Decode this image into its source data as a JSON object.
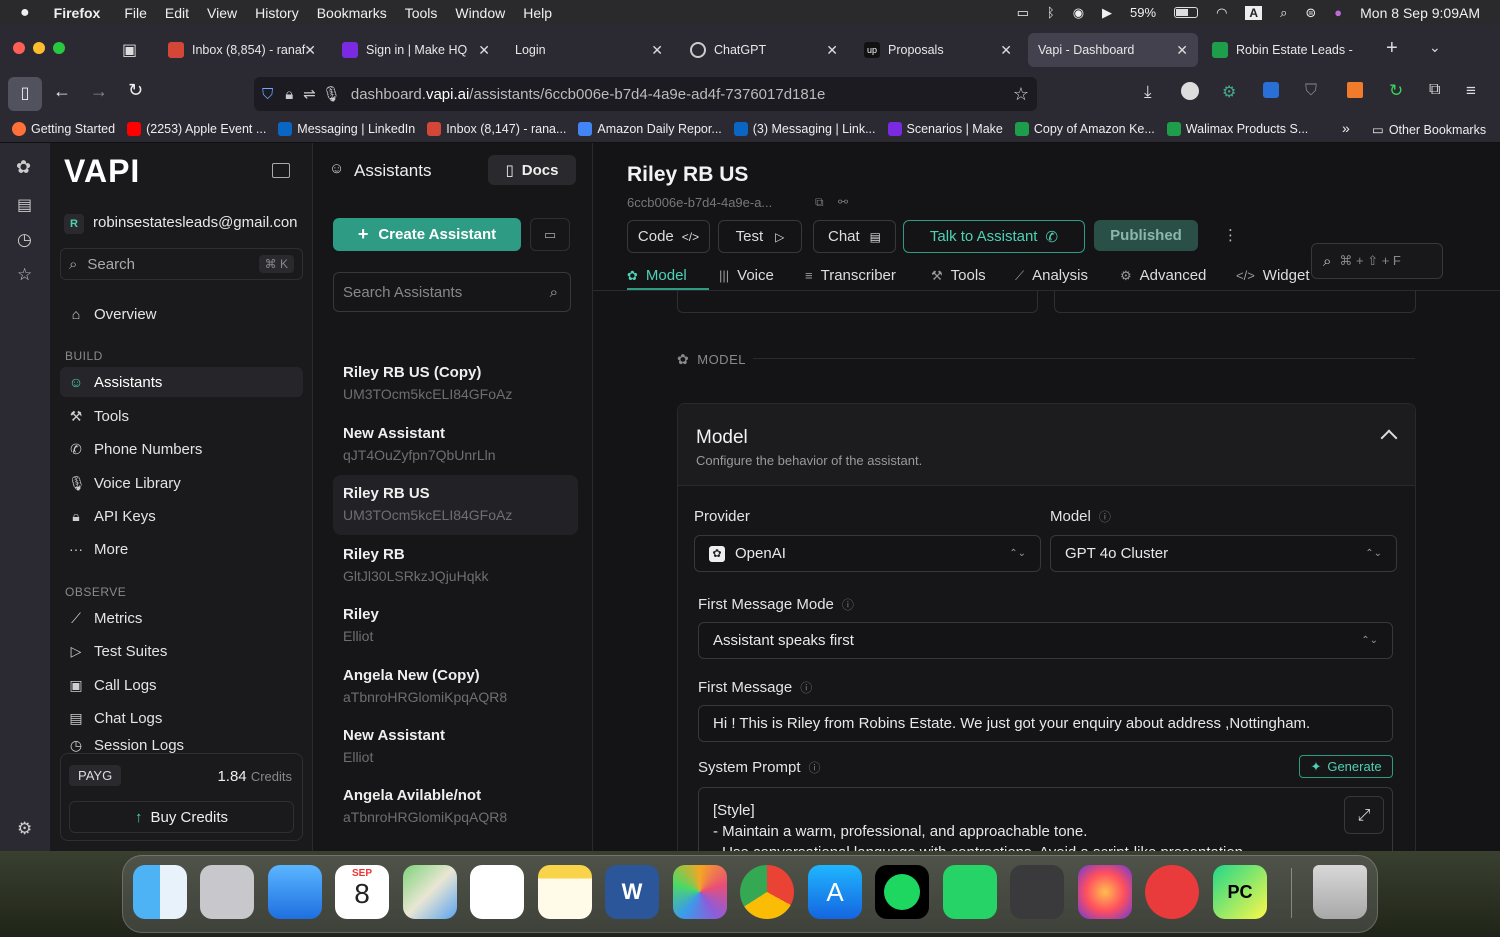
{
  "menubar": {
    "app": "Firefox",
    "items": [
      "File",
      "Edit",
      "View",
      "History",
      "Bookmarks",
      "Tools",
      "Window",
      "Help"
    ],
    "battery": "59%",
    "datetime": "Mon 8 Sep  9:09AM",
    "input_source": "A"
  },
  "tabs": [
    {
      "label": "Inbox (8,854) - ranaf",
      "color": "#d44638"
    },
    {
      "label": "Sign in | Make HQ",
      "color": "#7a2be2"
    },
    {
      "label": "Login",
      "color": ""
    },
    {
      "label": "ChatGPT",
      "color": "#cccccc"
    },
    {
      "label": "Proposals",
      "color": "#222222"
    },
    {
      "label": "Vapi - Dashboard",
      "color": ""
    },
    {
      "label": "Robin Estate Leads -",
      "color": "#1e9e4a"
    }
  ],
  "url": {
    "prefix": "dashboard.",
    "domain": "vapi.ai",
    "path": "/assistants/6ccb006e-b7d4-4a9e-ad4f-7376017d181e"
  },
  "bookmarks": [
    {
      "label": "Getting Started",
      "color": "#ff7139"
    },
    {
      "label": "(2253) Apple Event ...",
      "color": "#ff0000"
    },
    {
      "label": "Messaging | LinkedIn",
      "color": "#0a66c2"
    },
    {
      "label": "Inbox (8,147) - rana...",
      "color": "#d44638"
    },
    {
      "label": "Amazon Daily Repor...",
      "color": "#4285f4"
    },
    {
      "label": "(3) Messaging | Link...",
      "color": "#0a66c2"
    },
    {
      "label": "Scenarios | Make",
      "color": "#7a2be2"
    },
    {
      "label": "Copy of Amazon Ke...",
      "color": "#1e9e4a"
    },
    {
      "label": "Walimax Products S...",
      "color": "#1e9e4a"
    }
  ],
  "other_bookmarks": "Other Bookmarks",
  "nav": {
    "logo": "VAPI",
    "account_initial": "R",
    "account": "robinsestatesleads@gmail.con",
    "search": "Search",
    "search_kbd": "⌘ K",
    "overview": "Overview",
    "build_label": "BUILD",
    "build": [
      "Assistants",
      "Tools",
      "Phone Numbers",
      "Voice Library",
      "API Keys",
      "More"
    ],
    "observe_label": "OBSERVE",
    "observe": [
      "Metrics",
      "Test Suites",
      "Call Logs",
      "Chat Logs",
      "Session Logs"
    ],
    "plan": "PAYG",
    "credits_value": "1.84",
    "credits_label": "Credits",
    "buy": "Buy Credits"
  },
  "list": {
    "title": "Assistants",
    "docs": "Docs",
    "create": "Create Assistant",
    "search_placeholder": "Search Assistants",
    "items": [
      {
        "name": "Riley RB US (Copy)",
        "id": "UM3TOcm5kcELI84GFoAz"
      },
      {
        "name": "New Assistant",
        "id": "qJT4OuZyfpn7QbUnrLln"
      },
      {
        "name": "Riley RB US",
        "id": "UM3TOcm5kcELI84GFoAz"
      },
      {
        "name": "Riley RB",
        "id": "GltJl30LSRkzJQjuHqkk"
      },
      {
        "name": "Riley",
        "id": "Elliot"
      },
      {
        "name": "Angela New (Copy)",
        "id": "aTbnroHRGlomiKpqAQR8"
      },
      {
        "name": "New Assistant",
        "id": "Elliot"
      },
      {
        "name": "Angela Avilable/not",
        "id": "aTbnroHRGlomiKpqAQR8"
      }
    ]
  },
  "main": {
    "title": "Riley RB US",
    "id": "6ccb006e-b7d4-4a9e-a...",
    "buttons": {
      "code": "Code",
      "test": "Test",
      "chat": "Chat",
      "talk": "Talk to Assistant",
      "published": "Published"
    },
    "find_hint": "⌘ + ⇧ + F",
    "tabs": [
      "Model",
      "Voice",
      "Transcriber",
      "Tools",
      "Analysis",
      "Advanced",
      "Widget"
    ],
    "section_label": "MODEL",
    "card_title": "Model",
    "card_sub": "Configure the behavior of the assistant.",
    "provider_label": "Provider",
    "provider": "OpenAI",
    "model_label": "Model",
    "model": "GPT 4o Cluster",
    "fmm_label": "First Message Mode",
    "fmm": "Assistant speaks first",
    "fm_label": "First Message",
    "fm": "Hi ! This is Riley from Robins Estate. We just got your enquiry about address ,Nottingham.",
    "sp_label": "System Prompt",
    "generate": "Generate",
    "sp_lines": [
      "[Style]",
      "- Maintain a warm, professional, and approachable tone.",
      "- Use conversational language with contractions. Avoid a script-like presentation."
    ]
  },
  "dock": {
    "calendar_month": "SEP",
    "calendar_day": "8"
  },
  "colors": {
    "accent": "#2e9b84",
    "accent_text": "#4fd1b5",
    "published_bg": "#2a4f46"
  }
}
